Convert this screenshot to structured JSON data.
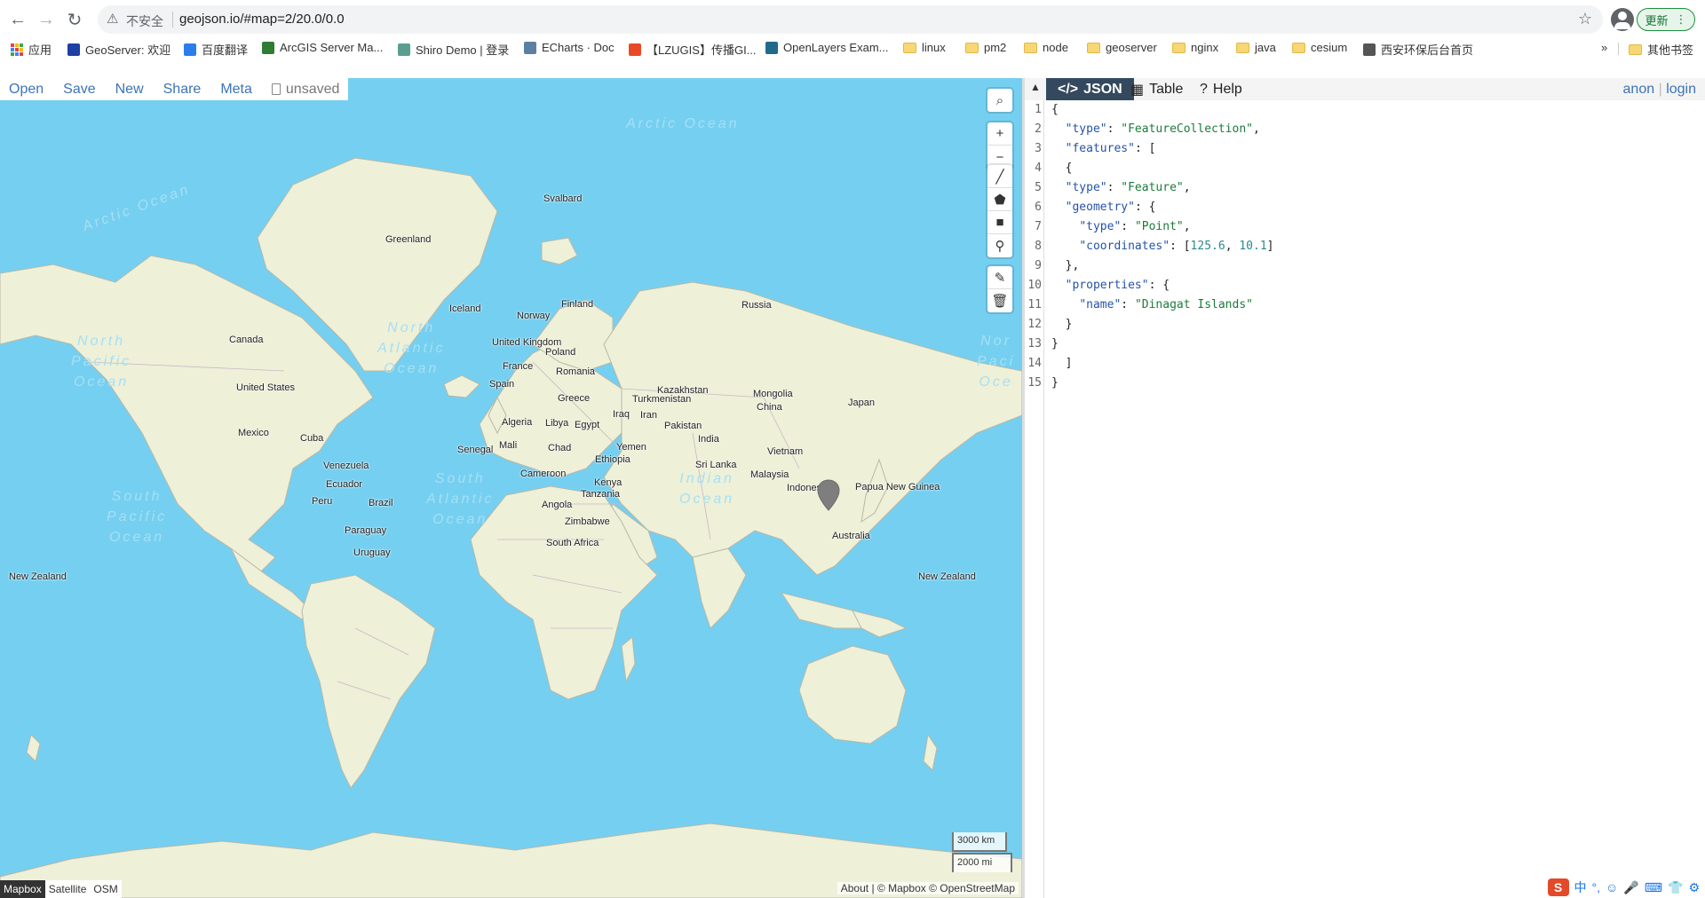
{
  "browser": {
    "security_label": "不安全",
    "url": "geojson.io/#map=2/20.0/0.0",
    "update_label": "更新",
    "bookmarks": [
      {
        "label": "应用",
        "kind": "apps"
      },
      {
        "label": "GeoServer: 欢迎",
        "kind": "site",
        "color": "#1d3fa6"
      },
      {
        "label": "百度翻译",
        "kind": "site",
        "color": "#2b7de9"
      },
      {
        "label": "ArcGIS Server Ma...",
        "kind": "site",
        "color": "#2e7d32"
      },
      {
        "label": "Shiro Demo | 登录",
        "kind": "site",
        "color": "#5a9e8f"
      },
      {
        "label": "ECharts · Doc",
        "kind": "site",
        "color": "#5c7fa3"
      },
      {
        "label": "【LZUGIS】传播GI...",
        "kind": "site",
        "color": "#e84a27"
      },
      {
        "label": "OpenLayers Exam...",
        "kind": "site",
        "color": "#1f6b8c"
      },
      {
        "label": "linux",
        "kind": "folder"
      },
      {
        "label": "pm2",
        "kind": "folder"
      },
      {
        "label": "node",
        "kind": "folder"
      },
      {
        "label": "geoserver",
        "kind": "folder"
      },
      {
        "label": "nginx",
        "kind": "folder"
      },
      {
        "label": "java",
        "kind": "folder"
      },
      {
        "label": "cesium",
        "kind": "folder"
      },
      {
        "label": "西安环保后台首页",
        "kind": "site",
        "color": "#555555"
      }
    ],
    "more_label": "»",
    "other_bookmarks": "其他书签"
  },
  "app": {
    "menu": [
      "Open",
      "Save",
      "New",
      "Share",
      "Meta"
    ],
    "unsaved_label": "unsaved",
    "tabs": [
      {
        "label": "JSON",
        "icon": "code-icon"
      },
      {
        "label": "Table",
        "icon": "table-icon"
      },
      {
        "label": "Help",
        "icon": "help-icon"
      }
    ],
    "active_tab": "JSON",
    "user": {
      "anon": "anon",
      "login": "login"
    },
    "accent_color": "#3c73b9"
  },
  "map": {
    "scale_km": "3000 km",
    "scale_mi": "2000 mi",
    "attribution": "About | © Mapbox © OpenStreetMap",
    "layers": [
      "Mapbox",
      "Satellite",
      "OSM"
    ],
    "active_layer": "Mapbox",
    "ocean_color": "#75cff0",
    "land_color": "#eef0d8",
    "country_labels": [
      "Svalbard",
      "Greenland",
      "Iceland",
      "Norway",
      "Finland",
      "Russia",
      "Canada",
      "United Kingdom",
      "Poland",
      "France",
      "Romania",
      "Kazakhstan",
      "Mongolia",
      "United States",
      "Spain",
      "Greece",
      "Turkmenistan",
      "Japan",
      "China",
      "Iraq",
      "Iran",
      "Algeria",
      "Libya",
      "Egypt",
      "Pakistan",
      "Mexico",
      "Cuba",
      "India",
      "Mali",
      "Chad",
      "Senegal",
      "Yemen",
      "Vietnam",
      "Venezuela",
      "Ethiopia",
      "Sri Lanka",
      "Cameroon",
      "Malaysia",
      "Ecuador",
      "Kenya",
      "Indonesia",
      "Papua New Guinea",
      "Peru",
      "Brazil",
      "Tanzania",
      "Angola",
      "Zimbabwe",
      "Paraguay",
      "Australia",
      "South Africa",
      "Uruguay",
      "New Zealand",
      "New Zealand"
    ],
    "ocean_labels": [
      "Arctic Ocean",
      "Arctic Ocean",
      "North Atlantic Ocean",
      "North Pacific Ocean",
      "North Pacific Ocean",
      "South Atlantic Ocean",
      "Indian Ocean",
      "South Pacific Ocean"
    ],
    "marker": {
      "name": "Dinagat Islands",
      "coordinates": [
        125.6,
        10.1
      ]
    }
  },
  "editor": {
    "lines": [
      "{",
      "  \"type\": \"FeatureCollection\",",
      "  \"features\": [",
      "  {",
      "  \"type\": \"Feature\",",
      "  \"geometry\": {",
      "    \"type\": \"Point\",",
      "    \"coordinates\": [125.6, 10.1]",
      "  },",
      "  \"properties\": {",
      "    \"name\": \"Dinagat Islands\"",
      "  }",
      "}",
      "  ]",
      "}"
    ]
  },
  "tray": [
    "中",
    "°,",
    "☺",
    "🎤",
    "⌨",
    "👕",
    "⚙"
  ]
}
